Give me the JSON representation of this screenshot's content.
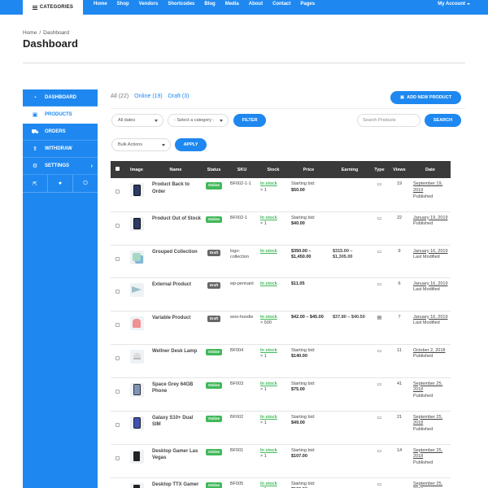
{
  "nav": {
    "categories_label": "CATEGORIES",
    "links": [
      "Home",
      "Shop",
      "Vendors",
      "Shortcodes",
      "Blog",
      "Media",
      "About",
      "Contact",
      "Pages"
    ],
    "account_label": "My Account"
  },
  "breadcrumb": {
    "home": "Home",
    "sep": "/",
    "current": "Dashboard"
  },
  "page_title": "Dashboard",
  "sidebar": {
    "items": [
      {
        "label": "DASHBOARD",
        "icon": "dashboard-icon"
      },
      {
        "label": "PRODUCTS",
        "icon": "briefcase-icon"
      },
      {
        "label": "ORDERS",
        "icon": "cart-icon"
      },
      {
        "label": "WITHDRAW",
        "icon": "upload-icon"
      },
      {
        "label": "SETTINGS",
        "icon": "gear-icon"
      }
    ],
    "bottom_icons": [
      "external-link-icon",
      "user-icon",
      "power-icon"
    ]
  },
  "filters": {
    "all": "All (22)",
    "online": "Online (19)",
    "draft": "Draft (3)",
    "add_new_label": "ADD NEW PRODUCT",
    "dates_label": "All dates",
    "category_label": "- Select a category -",
    "filter_label": "FILTER",
    "search_placeholder": "Search Products",
    "search_label": "SEARCH",
    "bulk_label": "Bulk Actions",
    "apply_label": "APPLY"
  },
  "table": {
    "headers": [
      "Image",
      "Name",
      "Status",
      "SKU",
      "Stock",
      "Price",
      "Earning",
      "Type",
      "Views",
      "Date"
    ],
    "rows": [
      {
        "thumb": "phone",
        "name": "Product Back to Order",
        "status": "Online",
        "sku": "BF002-1-1",
        "stock": "In stock",
        "qty": "× 1",
        "price_pre": "Starting bid:",
        "price": "$50.00",
        "earning": "",
        "views": "19",
        "date": "September 19, 2019",
        "date_status": "Published"
      },
      {
        "thumb": "phone",
        "name": "Product Out of Stock",
        "status": "Online",
        "sku": "BF002-1",
        "stock": "In stock",
        "qty": "× 1",
        "price_pre": "Starting bid:",
        "price": "$40.00",
        "earning": "",
        "views": "22",
        "date": "January 19, 2019",
        "date_status": "Published"
      },
      {
        "thumb": "group",
        "name": "Grouped Collection",
        "status": "Draft",
        "sku": "logo-collection",
        "stock": "In stock",
        "qty": "",
        "price_pre": "",
        "price": "$350.00 – $1,450.00",
        "earning": "$315.00 – $1,305.00",
        "views": "9",
        "date": "January 16, 2019",
        "date_status": "Last Modified"
      },
      {
        "thumb": "pennant",
        "name": "External Product",
        "status": "Draft",
        "sku": "wp-pennant",
        "stock": "In stock",
        "qty": "",
        "price_pre": "",
        "price": "$11.05",
        "earning": "",
        "views": "6",
        "date": "January 16, 2019",
        "date_status": "Last Modified"
      },
      {
        "thumb": "hoodie",
        "name": "Variable Product",
        "status": "Draft",
        "sku": "woo-hoodie",
        "stock": "In stock",
        "qty": "× 500",
        "price_pre": "",
        "price": "$42.00 – $45.00",
        "earning": "$37.80 – $40.50",
        "views": "7",
        "date": "January 16, 2019",
        "date_status": "Last Modified"
      },
      {
        "thumb": "lamp",
        "name": "Wellner Desk Lamp",
        "status": "Online",
        "sku": "BF004",
        "stock": "In stock",
        "qty": "× 1",
        "price_pre": "Starting bid:",
        "price": "$140.00",
        "earning": "",
        "views": "11",
        "date": "October 2, 2018",
        "date_status": "Published"
      },
      {
        "thumb": "phone2",
        "name": "Space Grey 64GB Phone",
        "status": "Online",
        "sku": "BF003",
        "stock": "In stock",
        "qty": "× 1",
        "price_pre": "Starting bid:",
        "price": "$75.00",
        "earning": "",
        "views": "41",
        "date": "September 25, 2018",
        "date_status": "Published"
      },
      {
        "thumb": "galaxy",
        "name": "Galaxy S10+ Dual SIM",
        "status": "Online",
        "sku": "BF002",
        "stock": "In stock",
        "qty": "× 1",
        "price_pre": "Starting bid:",
        "price": "$49.00",
        "earning": "",
        "views": "21",
        "date": "September 25, 2018",
        "date_status": "Published"
      },
      {
        "thumb": "gamer",
        "name": "Desktop Gamer Las Vegas",
        "status": "Online",
        "sku": "BF001",
        "stock": "In stock",
        "qty": "× 1",
        "price_pre": "Starting bid:",
        "price": "$107.00",
        "earning": "",
        "views": "14",
        "date": "September 25, 2018",
        "date_status": "Published"
      },
      {
        "thumb": "gamer",
        "name": "Desktop TTX Gamer",
        "status": "Online",
        "sku": "BF005",
        "stock": "In stock",
        "qty": "× 1",
        "price_pre": "Starting bid:",
        "price": "$100.00",
        "earning": "",
        "views": "",
        "date": "September 25, 2018",
        "date_status": "Published"
      }
    ]
  }
}
